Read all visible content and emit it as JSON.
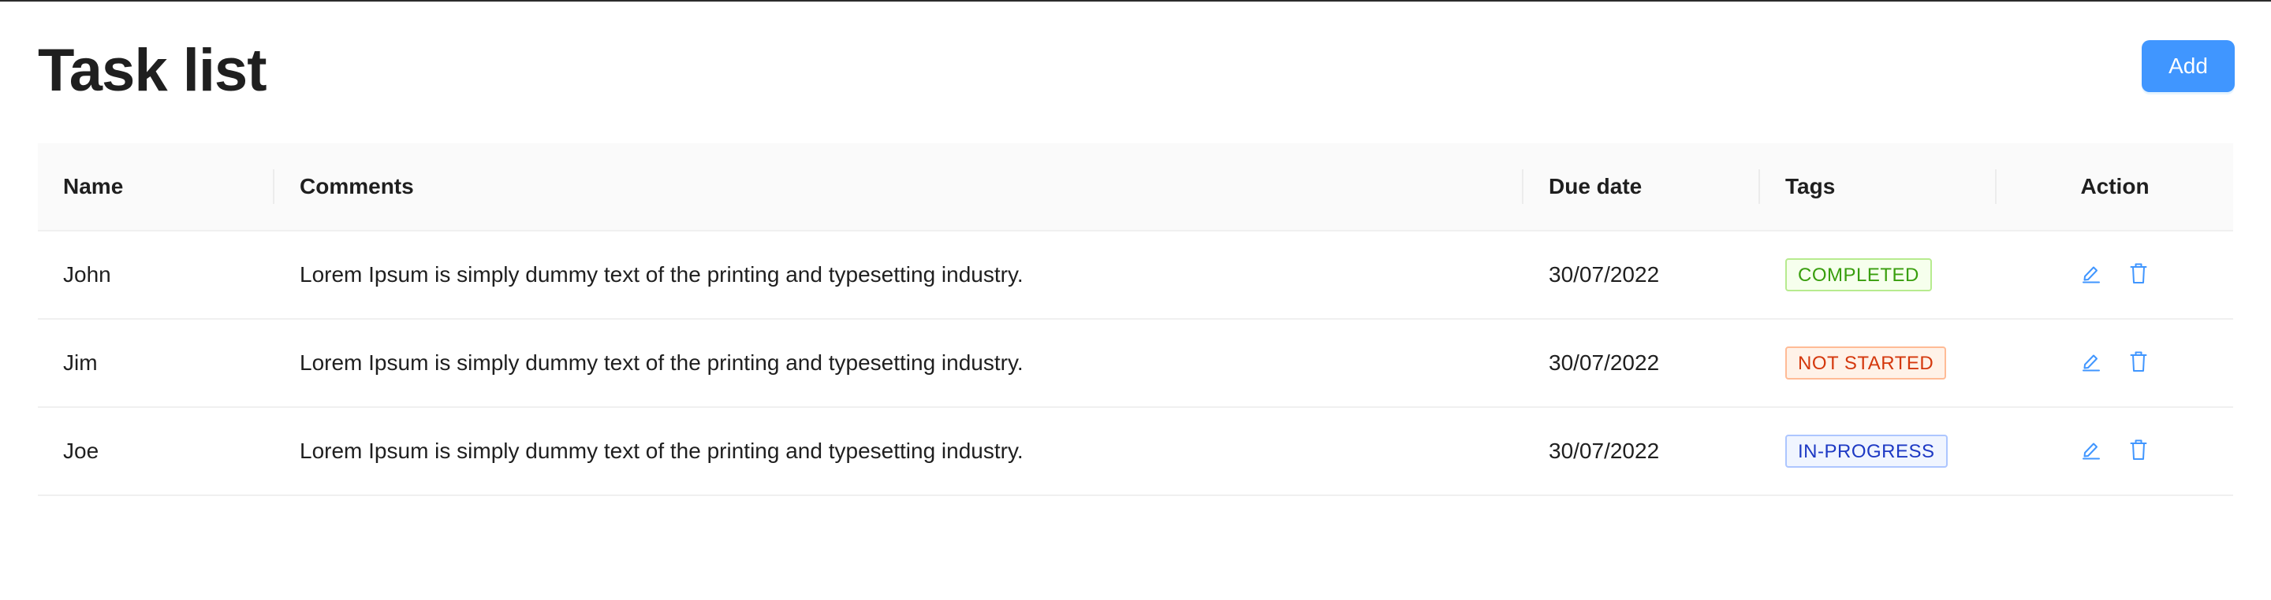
{
  "header": {
    "title": "Task list",
    "add_label": "Add"
  },
  "table": {
    "columns": [
      "Name",
      "Comments",
      "Due date",
      "Tags",
      "Action"
    ],
    "rows": [
      {
        "name": "John",
        "comment": "Lorem Ipsum is simply dummy text of the printing and typesetting industry.",
        "due": "30/07/2022",
        "tag": "COMPLETED",
        "tag_style": {
          "color": "#389e0d",
          "bg": "#f6ffed",
          "border": "#b7eb8f"
        }
      },
      {
        "name": "Jim",
        "comment": "Lorem Ipsum is simply dummy text of the printing and typesetting industry.",
        "due": "30/07/2022",
        "tag": "NOT STARTED",
        "tag_style": {
          "color": "#d4380d",
          "bg": "#fff2e8",
          "border": "#ffbb96"
        }
      },
      {
        "name": "Joe",
        "comment": "Lorem Ipsum is simply dummy text of the printing and typesetting industry.",
        "due": "30/07/2022",
        "tag": "IN-PROGRESS",
        "tag_style": {
          "color": "#1d39c4",
          "bg": "#f0f5ff",
          "border": "#adc6ff"
        }
      }
    ],
    "action_icons": [
      "edit-icon",
      "delete-icon"
    ]
  },
  "colors": {
    "primary": "#4096ff",
    "header_bg": "#fafafa",
    "row_border": "#f0f0f0"
  }
}
